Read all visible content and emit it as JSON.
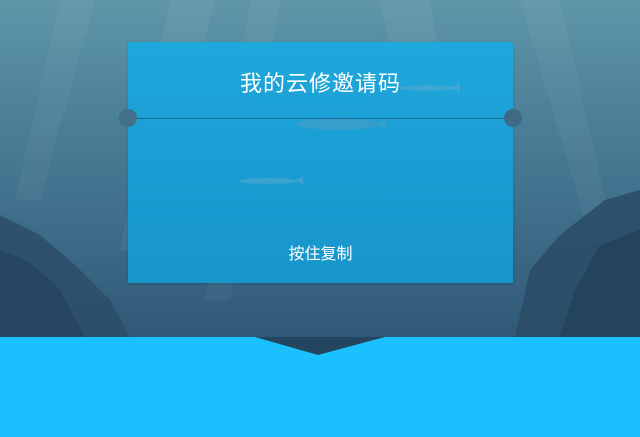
{
  "card": {
    "title": "我的云修邀请码",
    "copy_hint": "按住复制"
  },
  "colors": {
    "card_blue": "#1a9dd3",
    "bottom_band": "#1ac1fe",
    "background_deep": "#2b4e6c",
    "text": "#ffffff"
  }
}
